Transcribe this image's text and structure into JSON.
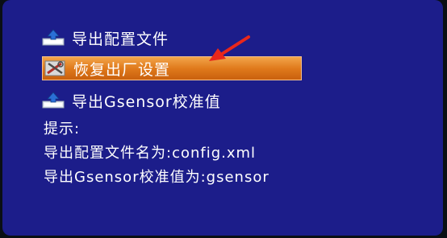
{
  "menu": {
    "items": [
      {
        "label": "导出配置文件",
        "icon": "export-disk-icon"
      },
      {
        "label": "恢复出厂设置",
        "icon": "factory-reset-tools-icon",
        "selected": true
      },
      {
        "label": "导出Gsensor校准值",
        "icon": "export-disk-icon"
      }
    ]
  },
  "info": {
    "heading": "提示:",
    "line1": "导出配置文件名为:config.xml",
    "line2": "导出Gsensor校准值为:gsensor"
  },
  "colors": {
    "screen_background": "#1c1d8a",
    "highlight": "#e07a1c",
    "text": "#ffffff",
    "pointer_arrow": "#e8271b"
  }
}
